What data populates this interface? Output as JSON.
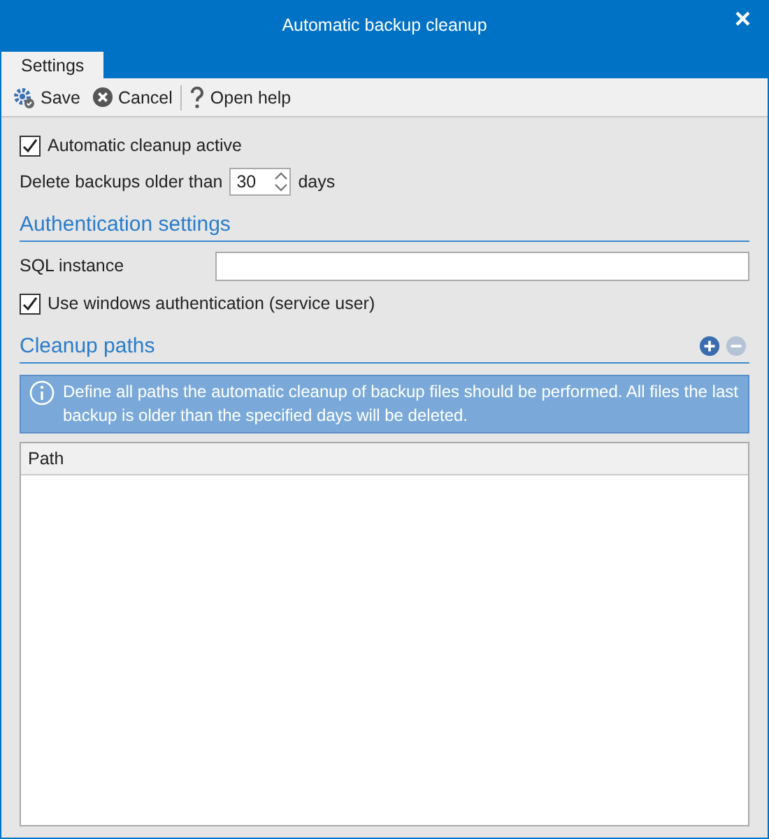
{
  "window": {
    "title": "Automatic backup cleanup",
    "close": "×"
  },
  "tabs": [
    {
      "label": "Settings",
      "selected": true
    }
  ],
  "toolbar": [
    {
      "kind": "save",
      "label": "Save"
    },
    {
      "kind": "cancel",
      "label": "Cancel"
    },
    {
      "kind": "help",
      "label": "Open help"
    }
  ],
  "cleanup_active": {
    "label": "Automatic cleanup active",
    "checked": true
  },
  "retention": {
    "label": "Delete backups older than",
    "value": "30",
    "unit": "days"
  },
  "auth_section": {
    "title": "Authentication settings",
    "sql_label": "SQL instance",
    "windows_auth": {
      "label": "Use windows authentication (service user)",
      "checked": true
    }
  },
  "paths_section": {
    "title": "Cleanup paths",
    "add_disabled": false,
    "remove_disabled": true,
    "info": "Define all paths the automatic cleanup of backup files should be performed. All files the last backup is older than the specified days will be deleted.",
    "table": {
      "columns": [
        "Path"
      ]
    }
  }
}
